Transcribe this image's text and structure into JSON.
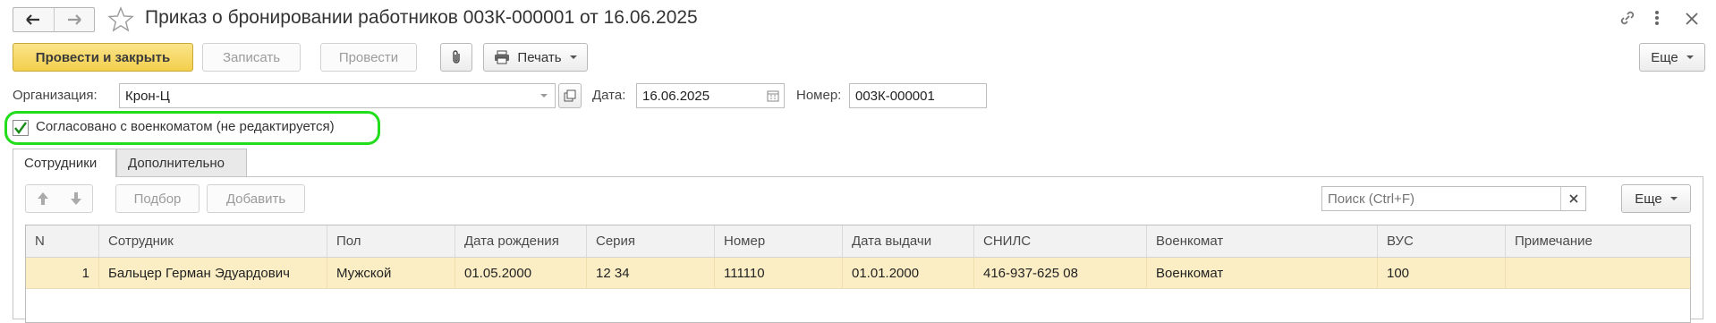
{
  "window": {
    "title": "Приказ о бронировании работников 003К-000001 от 16.06.2025"
  },
  "toolbar": {
    "post_and_close": "Провести и закрыть",
    "save": "Записать",
    "post": "Провести",
    "print": "Печать",
    "more": "Еще"
  },
  "header": {
    "org_label": "Организация:",
    "org_value": "Крон-Ц",
    "date_label": "Дата:",
    "date_value": "16.06.2025",
    "number_label": "Номер:",
    "number_value": "003К-000001"
  },
  "approval": {
    "checked": true,
    "label": "Согласовано с военкоматом (не редактируется)",
    "highlight_color": "#22dd1b"
  },
  "tabs": [
    {
      "label": "Сотрудники",
      "active": true
    },
    {
      "label": "Дополнительно",
      "active": false
    }
  ],
  "table_toolbar": {
    "pick": "Подбор",
    "add": "Добавить",
    "search_placeholder": "Поиск (Ctrl+F)",
    "more": "Еще"
  },
  "table": {
    "columns": [
      "N",
      "Сотрудник",
      "Пол",
      "Дата рождения",
      "Серия",
      "Номер",
      "Дата выдачи",
      "СНИЛС",
      "Военкомат",
      "ВУС",
      "Примечание"
    ],
    "rows": [
      [
        "1",
        "Бальцер Герман Эдуардович",
        "Мужской",
        "01.05.2000",
        "12 34",
        "111110",
        "01.01.2000",
        "416-937-625 08",
        "Военкомат",
        "100",
        ""
      ]
    ]
  },
  "colors": {
    "primary_button": "#f3cf4c",
    "selected_row": "#fbeec4"
  }
}
